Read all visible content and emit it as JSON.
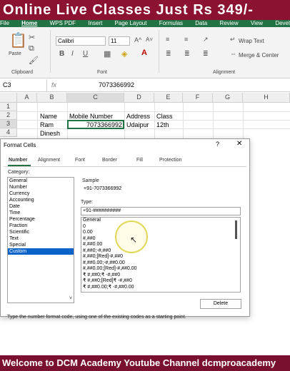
{
  "banner_top": "Online Live Classes Just Rs 349/-",
  "banner_bottom": "Welcome to DCM Academy Youtube Channel dcmproacademy",
  "ribbon": {
    "tabs": [
      "File",
      "Home",
      "WPS PDF",
      "Insert",
      "Page Layout",
      "Formulas",
      "Data",
      "Review",
      "View",
      "Develop"
    ],
    "active_tab": "Home",
    "paste_label": "Paste",
    "clipboard_label": "Clipboard",
    "font_name": "Calibri",
    "font_size": "11",
    "font_label": "Font",
    "bold": "B",
    "italic": "I",
    "underline": "U",
    "wrap_text": "Wrap Text",
    "merge_center": "Merge & Center",
    "alignment_label": "Alignment"
  },
  "formula_bar": {
    "name_box": "C3",
    "fx": "fx",
    "value": "7073366992"
  },
  "grid": {
    "columns": [
      "A",
      "B",
      "C",
      "D",
      "E",
      "F",
      "G",
      "H"
    ],
    "rows": [
      "1",
      "2",
      "3",
      "4"
    ],
    "cells": {
      "b2": "Name",
      "c2": "Mobile Number",
      "d2": "Address",
      "e2": "Class",
      "b3": "Ram",
      "c3": "7073366992",
      "d3": "Udaipur",
      "e3": "12th",
      "b4": "Dinesh"
    }
  },
  "dialog": {
    "title": "Format Cells",
    "help": "?",
    "close": "✕",
    "tabs": [
      "Number",
      "Alignment",
      "Font",
      "Border",
      "Fill",
      "Protection"
    ],
    "active_tab": "Number",
    "category_label": "Category:",
    "categories": [
      "General",
      "Number",
      "Currency",
      "Accounting",
      "Date",
      "Time",
      "Percentage",
      "Fraction",
      "Scientific",
      "Text",
      "Special",
      "Custom"
    ],
    "selected_category": "Custom",
    "sample_label": "Sample",
    "sample_value": "+91-7073366992",
    "type_label": "Type:",
    "type_value": "+91-##########",
    "formats": [
      "General",
      "0",
      "0.00",
      "#,##0",
      "#,##0.00",
      "#,##0;-#,##0",
      "#,##0;[Red]-#,##0",
      "#,##0.00;-#,##0.00",
      "#,##0.00;[Red]-#,##0.00",
      "₹ #,##0;₹ -#,##0",
      "₹ #,##0;[Red]₹ -#,##0",
      "₹ #,##0.00;₹ -#,##0.00"
    ],
    "delete_label": "Delete",
    "hint": "Type the number format code, using one of the existing codes as a starting point."
  }
}
